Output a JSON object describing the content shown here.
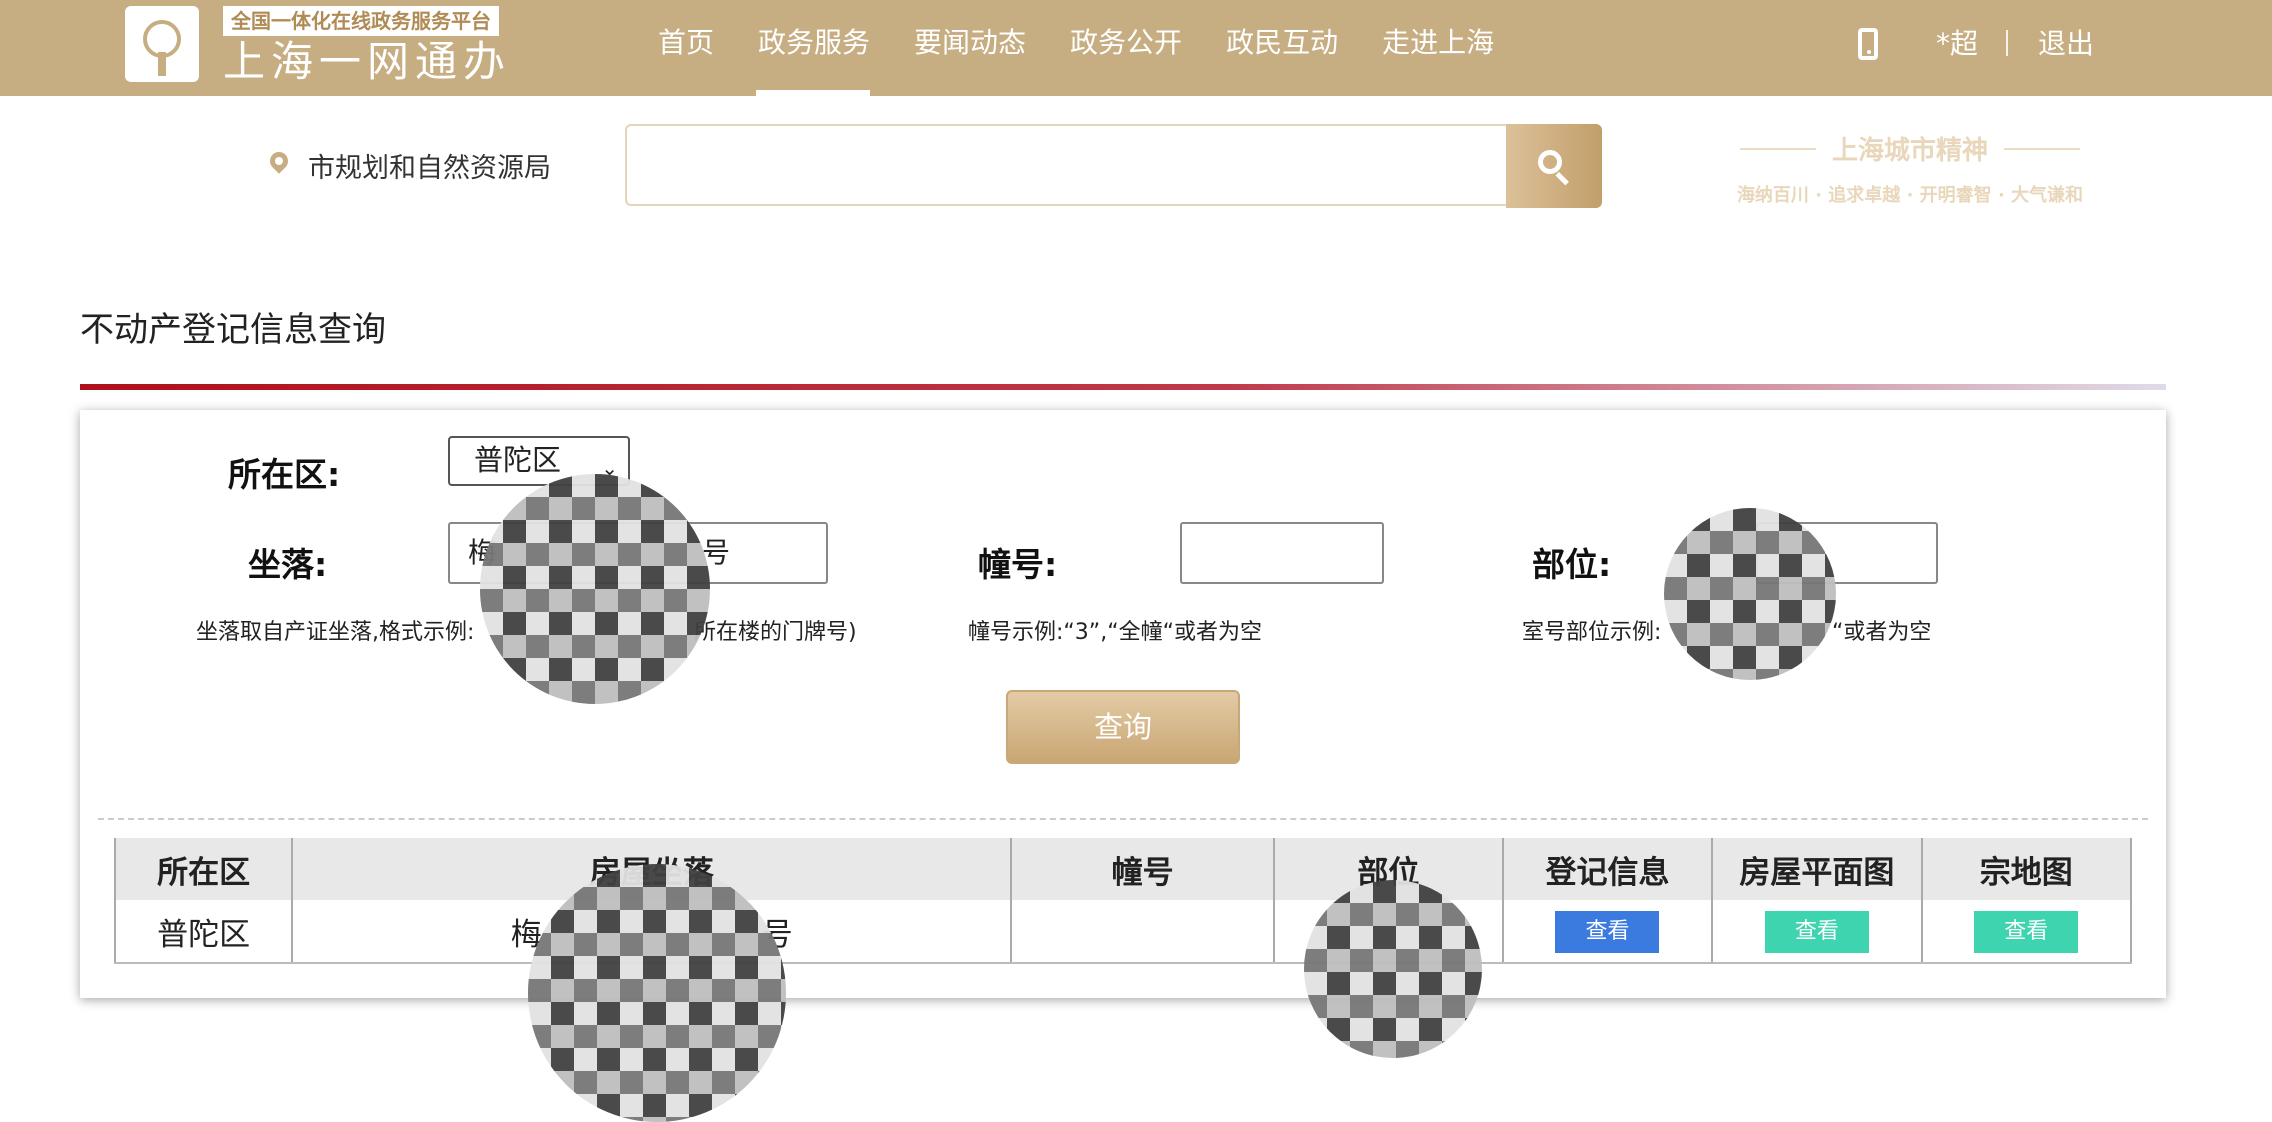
{
  "header": {
    "slogan": "全国一体化在线政务服务平台",
    "brand": "上海一网通办",
    "nav": [
      "首页",
      "政务服务",
      "要闻动态",
      "政务公开",
      "政民互动",
      "走进上海"
    ],
    "active_nav": "政务服务",
    "user": "*超",
    "logout": "退出"
  },
  "search": {
    "department": "市规划和自然资源局",
    "placeholder": "",
    "spirit_title": "上海城市精神",
    "spirit_sub": "海纳百川 · 追求卓越 · 开明睿智 · 大气谦和"
  },
  "page_title": "不动产登记信息查询",
  "form": {
    "district_label": "所在区:",
    "district_value": "普陀区",
    "location_label": "坐落:",
    "location_value_prefix": "梅",
    "location_value_suffix": "号",
    "building_label": "幢号:",
    "building_value": "",
    "unit_label": "部位:",
    "unit_value": "",
    "location_hint_prefix": "坐落取自产证坐落,格式示例:",
    "location_hint_suffix": "所在楼的门牌号)",
    "building_hint": "幢号示例:“3”,“全幢“或者为空",
    "unit_hint_prefix": "室号部位示例:",
    "unit_hint_suffix": "“或者为空",
    "query_button": "查询"
  },
  "table": {
    "headers": [
      "所在区",
      "房屋坐落",
      "幢号",
      "部位",
      "登记信息",
      "房屋平面图",
      "宗地图"
    ],
    "row": {
      "district": "普陀区",
      "location_prefix": "梅",
      "location_suffix": "号",
      "building": "",
      "unit": "",
      "reg_button": "查看",
      "plan_button": "查看",
      "land_button": "查看"
    },
    "colors": {
      "reg": "#3b7be0",
      "plan": "#3fd4b0",
      "land": "#3fd4b0"
    }
  },
  "colors": {
    "header": "#c7ad82",
    "accent_red": "#b0101a"
  }
}
